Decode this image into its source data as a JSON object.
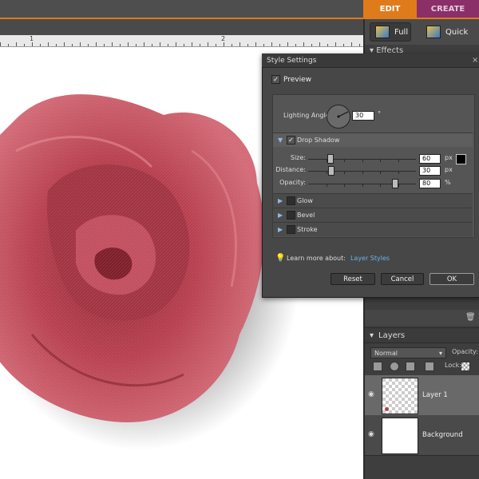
{
  "mode_tabs": {
    "edit": "EDIT",
    "create": "CREATE"
  },
  "mode_buttons": {
    "full": "Full",
    "quick": "Quick"
  },
  "ruler": {
    "marks": [
      "1",
      "2"
    ]
  },
  "effects": {
    "title": "Effects"
  },
  "layers": {
    "title": "Layers",
    "blend_mode": "Normal",
    "opacity_label": "Opacity:",
    "lock_label": "Lock:",
    "items": [
      {
        "name": "Layer 1",
        "selected": true
      },
      {
        "name": "Background",
        "selected": false
      }
    ]
  },
  "dialog": {
    "title": "Style Settings",
    "close_glyph": "×",
    "preview_label": "Preview",
    "preview_checked": true,
    "lighting_angle_label": "Lighting Angle:",
    "lighting_angle_value": "30",
    "lighting_angle_unit": "°",
    "sections": {
      "drop_shadow": {
        "label": "Drop Shadow",
        "checked": true,
        "expanded": true
      },
      "glow": {
        "label": "Glow",
        "checked": false
      },
      "bevel": {
        "label": "Bevel",
        "checked": false
      },
      "stroke": {
        "label": "Stroke",
        "checked": false
      }
    },
    "sliders": [
      {
        "label": "Size:",
        "value": "60",
        "unit": "px",
        "fraction": 0.2
      },
      {
        "label": "Distance:",
        "value": "30",
        "unit": "px",
        "fraction": 0.21
      },
      {
        "label": "Opacity:",
        "value": "80",
        "unit": "%",
        "fraction": 0.8
      }
    ],
    "shadow_color": "#000000",
    "learn_prefix": "Learn more about:",
    "learn_link": "Layer Styles",
    "buttons": {
      "reset": "Reset",
      "cancel": "Cancel",
      "ok": "OK"
    }
  },
  "colors": {
    "accent_orange": "#e07b1c",
    "create_tab": "#8b2f68",
    "rose": "#c44a5a",
    "link_blue": "#6bb3ea"
  },
  "icons": {
    "full_mode": "photo-edit-icon",
    "quick_mode": "quick-edit-icon",
    "trash": "trash-icon",
    "bulb": "lightbulb-icon",
    "eye": "eye-icon"
  }
}
